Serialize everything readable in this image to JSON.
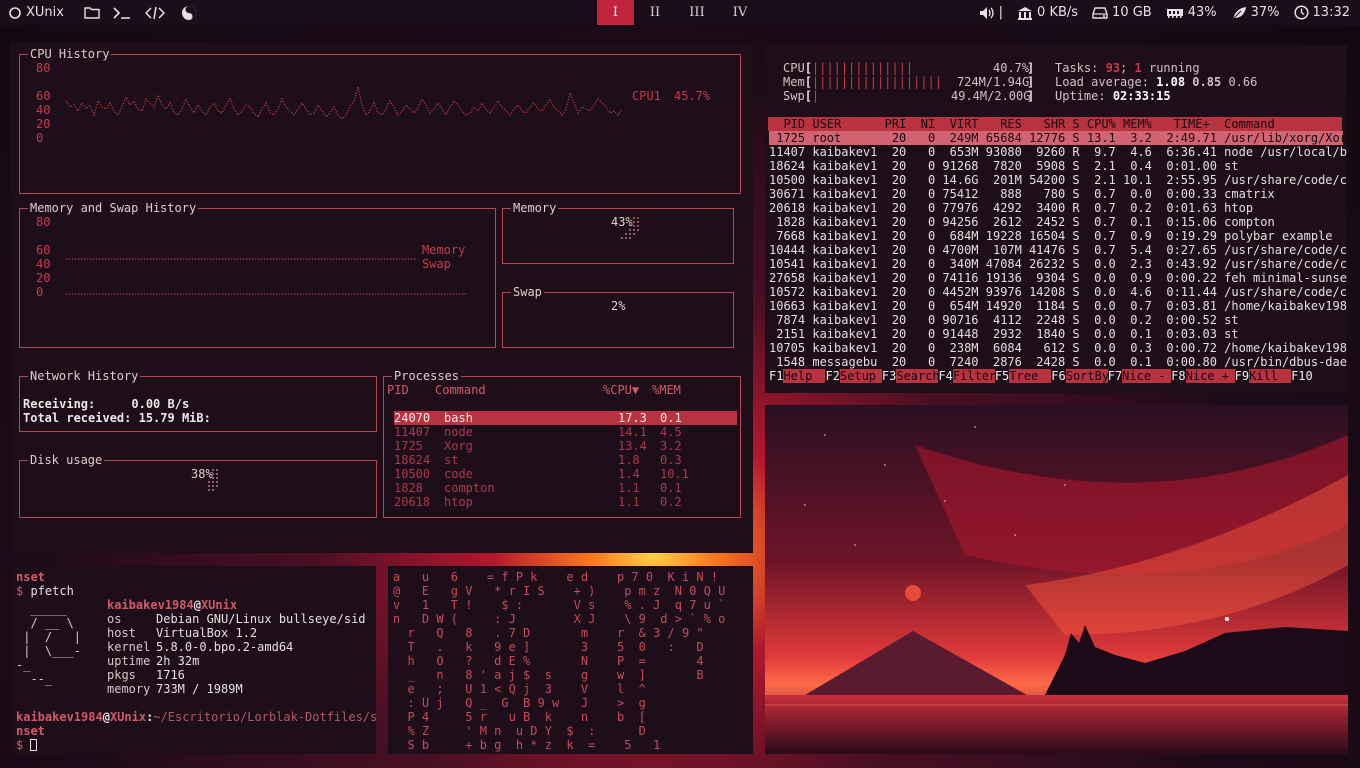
{
  "topbar": {
    "brand": "XUnix",
    "workspaces": [
      "I",
      "II",
      "III",
      "IV"
    ],
    "active_ws": 0,
    "volume_sep": "|",
    "net": "0 KB/s",
    "disk": "10 GB",
    "mem": "43%",
    "cpu": "37%",
    "clock": "13:32"
  },
  "monitor": {
    "cpu_title": "CPU History",
    "cpu_ticks": [
      "80",
      "60",
      "40",
      "20",
      "0"
    ],
    "cpu_legend_name": "CPU1",
    "cpu_legend_val": "45.7%",
    "mem_title": "Memory and Swap History",
    "mem_ticks": [
      "80",
      "60",
      "40",
      "20",
      "0"
    ],
    "mem_legend": [
      "Memory",
      "Swap"
    ],
    "memory_title": "Memory",
    "memory_val": "43%",
    "swap_title": "Swap",
    "swap_val": "2%",
    "net_title": "Network History",
    "net_recv_label": "Receiving:",
    "net_recv_val": "0.00 B/s",
    "net_total_label": "Total received:",
    "net_total_val": "15.79 MiB:",
    "disk_title": "Disk usage",
    "disk_val": "38%",
    "proc_title": "Processes",
    "proc_head": [
      "PID",
      "Command",
      "%CPU▼",
      "%MEM"
    ],
    "procs": [
      [
        "24070",
        "bash",
        "17.3",
        "0.1"
      ],
      [
        "11407",
        "node",
        "14.1",
        "4.5"
      ],
      [
        "1725",
        "Xorg",
        "13.4",
        "3.2"
      ],
      [
        "18624",
        "st",
        "1.8",
        "0.3"
      ],
      [
        "10500",
        "code",
        "1.4",
        "10.1"
      ],
      [
        "1828",
        "compton",
        "1.1",
        "0.1"
      ],
      [
        "20618",
        "htop",
        "1.1",
        "0.2"
      ]
    ]
  },
  "htop": {
    "cpu_label": "CPU",
    "cpu_bars": "||||||||||||||",
    "cpu_val": "40.7%",
    "mem_label": "Mem",
    "mem_bars": "||||||||||||||||||",
    "mem_val": "724M/1.94G",
    "swp_label": "Swp",
    "swp_bars": "|",
    "swp_val": "49.4M/2.00G",
    "tasks_label": "Tasks:",
    "tasks_val": "93",
    "tasks_sep": ";",
    "running_val": "1",
    "running_label": "running",
    "load_label": "Load average:",
    "load1": "1.08",
    "load5": "0.85",
    "load15": "0.66",
    "uptime_label": "Uptime:",
    "uptime_val": "02:33:15",
    "header": "  PID USER      PRI  NI  VIRT   RES   SHR S CPU% MEM%   TIME+  Command",
    "rows": [
      " 1725 root       20   0  249M 65684 12776 S 13.1  3.2  2:49.71 /usr/lib/xorg/Xorg",
      "11407 kaibakev1  20   0  653M 93080  9260 R  9.7  4.6  6:36.41 node /usr/local/bin",
      "18624 kaibakev1  20   0 91268  7820  5908 S  2.1  0.4  0:01.00 st",
      "10500 kaibakev1  20   0 14.6G  201M 54200 S  2.1 10.1  2:55.95 /usr/share/code/cod",
      "30671 kaibakev1  20   0 75412   888   780 S  0.7  0.0  0:00.33 cmatrix",
      "20618 kaibakev1  20   0 77976  4292  3400 R  0.7  0.2  0:01.63 htop",
      " 1828 kaibakev1  20   0 94256  2612  2452 S  0.7  0.1  0:15.06 compton",
      " 7668 kaibakev1  20   0  684M 19228 16504 S  0.7  0.9  0:19.29 polybar example",
      "10444 kaibakev1  20   0 4700M  107M 41476 S  0.7  5.4  0:27.65 /usr/share/code/cod",
      "10541 kaibakev1  20   0  340M 47084 26232 S  0.0  2.3  0:43.92 /usr/share/code/cod",
      "27658 kaibakev1  20   0 74116 19136  9304 S  0.0  0.9  0:00.22 feh minimal-sunset-",
      "10572 kaibakev1  20   0 4452M 93976 14208 S  0.0  4.6  0:11.44 /usr/share/code/cod",
      "10663 kaibakev1  20   0  654M 14920  1184 S  0.0  0.7  0:03.81 /home/kaibakev1984/",
      " 7874 kaibakev1  20   0 90716  4112  2248 S  0.0  0.2  0:00.52 st",
      " 2151 kaibakev1  20   0 91448  2932  1840 S  0.0  0.1  0:03.03 st",
      "10705 kaibakev1  20   0  238M  6084   612 S  0.0  0.3  0:00.72 /home/kaibakev1984/",
      " 1548 messagebu  20   0  7240  2876  2428 S  0.0  0.1  0:00.80 /usr/bin/dbus-daemo"
    ],
    "fkeys": [
      [
        "F1",
        "Help"
      ],
      [
        "F2",
        "Setup"
      ],
      [
        "F3",
        "Search"
      ],
      [
        "F4",
        "Filter"
      ],
      [
        "F5",
        "Tree"
      ],
      [
        "F6",
        "SortBy"
      ],
      [
        "F7",
        "Nice -"
      ],
      [
        "F8",
        "Nice +"
      ],
      [
        "F9",
        "Kill"
      ],
      [
        "F10",
        ""
      ]
    ]
  },
  "terminal": {
    "line0": "nset",
    "prompt": "$",
    "cmd": "pfetch",
    "user": "kaibakev1984",
    "at": "@",
    "host": "XUnix",
    "logo": [
      "  _____",
      "  / __ \\",
      " |  /   |",
      " |  \\___-",
      "-_",
      "  --_"
    ],
    "info": [
      [
        "os",
        "Debian GNU/Linux bullseye/sid"
      ],
      [
        "host",
        "VirtualBox 1.2"
      ],
      [
        "kernel",
        "5.8.0-0.bpo.2-amd64"
      ],
      [
        "uptime",
        "2h 32m"
      ],
      [
        "pkgs",
        "1716"
      ],
      [
        "memory",
        "733M / 1989M"
      ]
    ],
    "prompt_user": "kaibakev1984",
    "prompt_at": "@",
    "prompt_host": "XUnix",
    "prompt_colon": ":",
    "prompt_path": "~/Escritorio/Lorblak-Dotfiles/su",
    "line_wrap": "nset",
    "prompt2": "$"
  },
  "matrix": {
    "lines": [
      "a   u   6    = f P k    e d    p 7 0  K i N !",
      "@   E   g V   * r I S    + )    p m z  N 0 Q U",
      "v   1   T !    $ :       V s    % . J  q 7 u `",
      "n   D W (     : J        X J    \\ 9  d > ` % o",
      "  r   Q   8   . 7 D       m    r  & 3 / 9 \"",
      "  T   .   k   9 e ]       3    5  0   :   D",
      "  h   O   ?   d E %       N    P  =       4",
      "  _   n   8 ' a j $  s    g    w  ]       B",
      "  e   ;   U 1 < Q j  3    V    l  ^",
      "  : U j   Q _  G  B 9 w   J    >  g",
      "  P 4     5 r   u B  k    n    b  [",
      "  % Z     ' M n  u D Y  $  :      D",
      "  S b     + b g  h * z  k  =    5   1"
    ]
  }
}
